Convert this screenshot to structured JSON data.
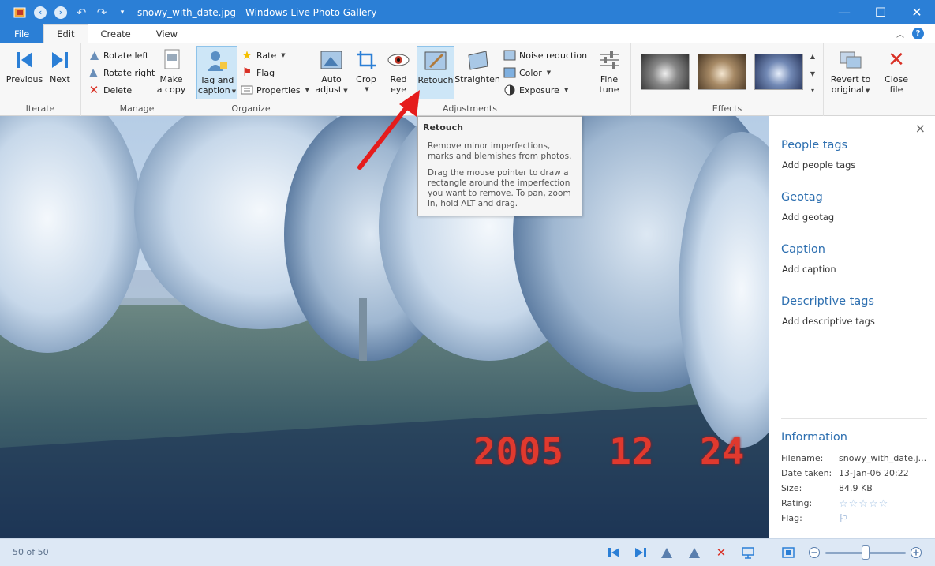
{
  "window": {
    "title": "snowy_with_date.jpg - Windows Live Photo Gallery",
    "minimize": "—",
    "maximize": "☐",
    "close": "✕"
  },
  "tabs": [
    "File",
    "Edit",
    "Create",
    "View"
  ],
  "ribbon": {
    "iterate": {
      "label": "Iterate",
      "previous": "Previous",
      "next": "Next"
    },
    "manage": {
      "label": "Manage",
      "rotate_left": "Rotate left",
      "rotate_right": "Rotate right",
      "delete": "Delete",
      "make_copy_1": "Make",
      "make_copy_2": "a copy"
    },
    "organize": {
      "label": "Organize",
      "tag_caption_1": "Tag and",
      "tag_caption_2": "caption",
      "rate": "Rate",
      "flag": "Flag",
      "properties": "Properties"
    },
    "adjustments": {
      "label": "Adjustments",
      "auto_adjust_1": "Auto",
      "auto_adjust_2": "adjust",
      "crop": "Crop",
      "red_eye_1": "Red",
      "red_eye_2": "eye",
      "retouch": "Retouch",
      "straighten": "Straighten",
      "noise_reduction": "Noise reduction",
      "color": "Color",
      "exposure": "Exposure",
      "fine_tune_1": "Fine",
      "fine_tune_2": "tune"
    },
    "effects": {
      "label": "Effects"
    },
    "revert_1": "Revert to",
    "revert_2": "original",
    "close_file_1": "Close",
    "close_file_2": "file"
  },
  "tooltip": {
    "title": "Retouch",
    "line1": "Remove minor imperfections, marks and blemishes from photos.",
    "line2": "Drag the mouse pointer to draw a rectangle around the imperfection you want to remove. To pan, zoom in, hold ALT and drag."
  },
  "photo": {
    "date_stamp": "2005  12  24"
  },
  "side_pane": {
    "close": "×",
    "people_tags": "People tags",
    "add_people_tags": "Add people tags",
    "geotag": "Geotag",
    "add_geotag": "Add geotag",
    "caption": "Caption",
    "add_caption": "Add caption",
    "descriptive_tags": "Descriptive tags",
    "add_descriptive_tags": "Add descriptive tags",
    "information": "Information",
    "info": [
      {
        "key": "Filename:",
        "value": "snowy_with_date.j..."
      },
      {
        "key": "Date taken:",
        "value": "13-Jan-06  20:22"
      },
      {
        "key": "Size:",
        "value": "84.9 KB"
      },
      {
        "key": "Rating:",
        "value": ""
      },
      {
        "key": "Flag:",
        "value": ""
      }
    ],
    "rating_stars": "☆☆☆☆☆",
    "flag_icon": "⚐"
  },
  "status": {
    "count": "50 of 50",
    "zoom_level": 0.5
  },
  "colors": {
    "accent": "#2b7fd6",
    "heading": "#2d6fb0",
    "status_bg": "#dde8f5"
  }
}
